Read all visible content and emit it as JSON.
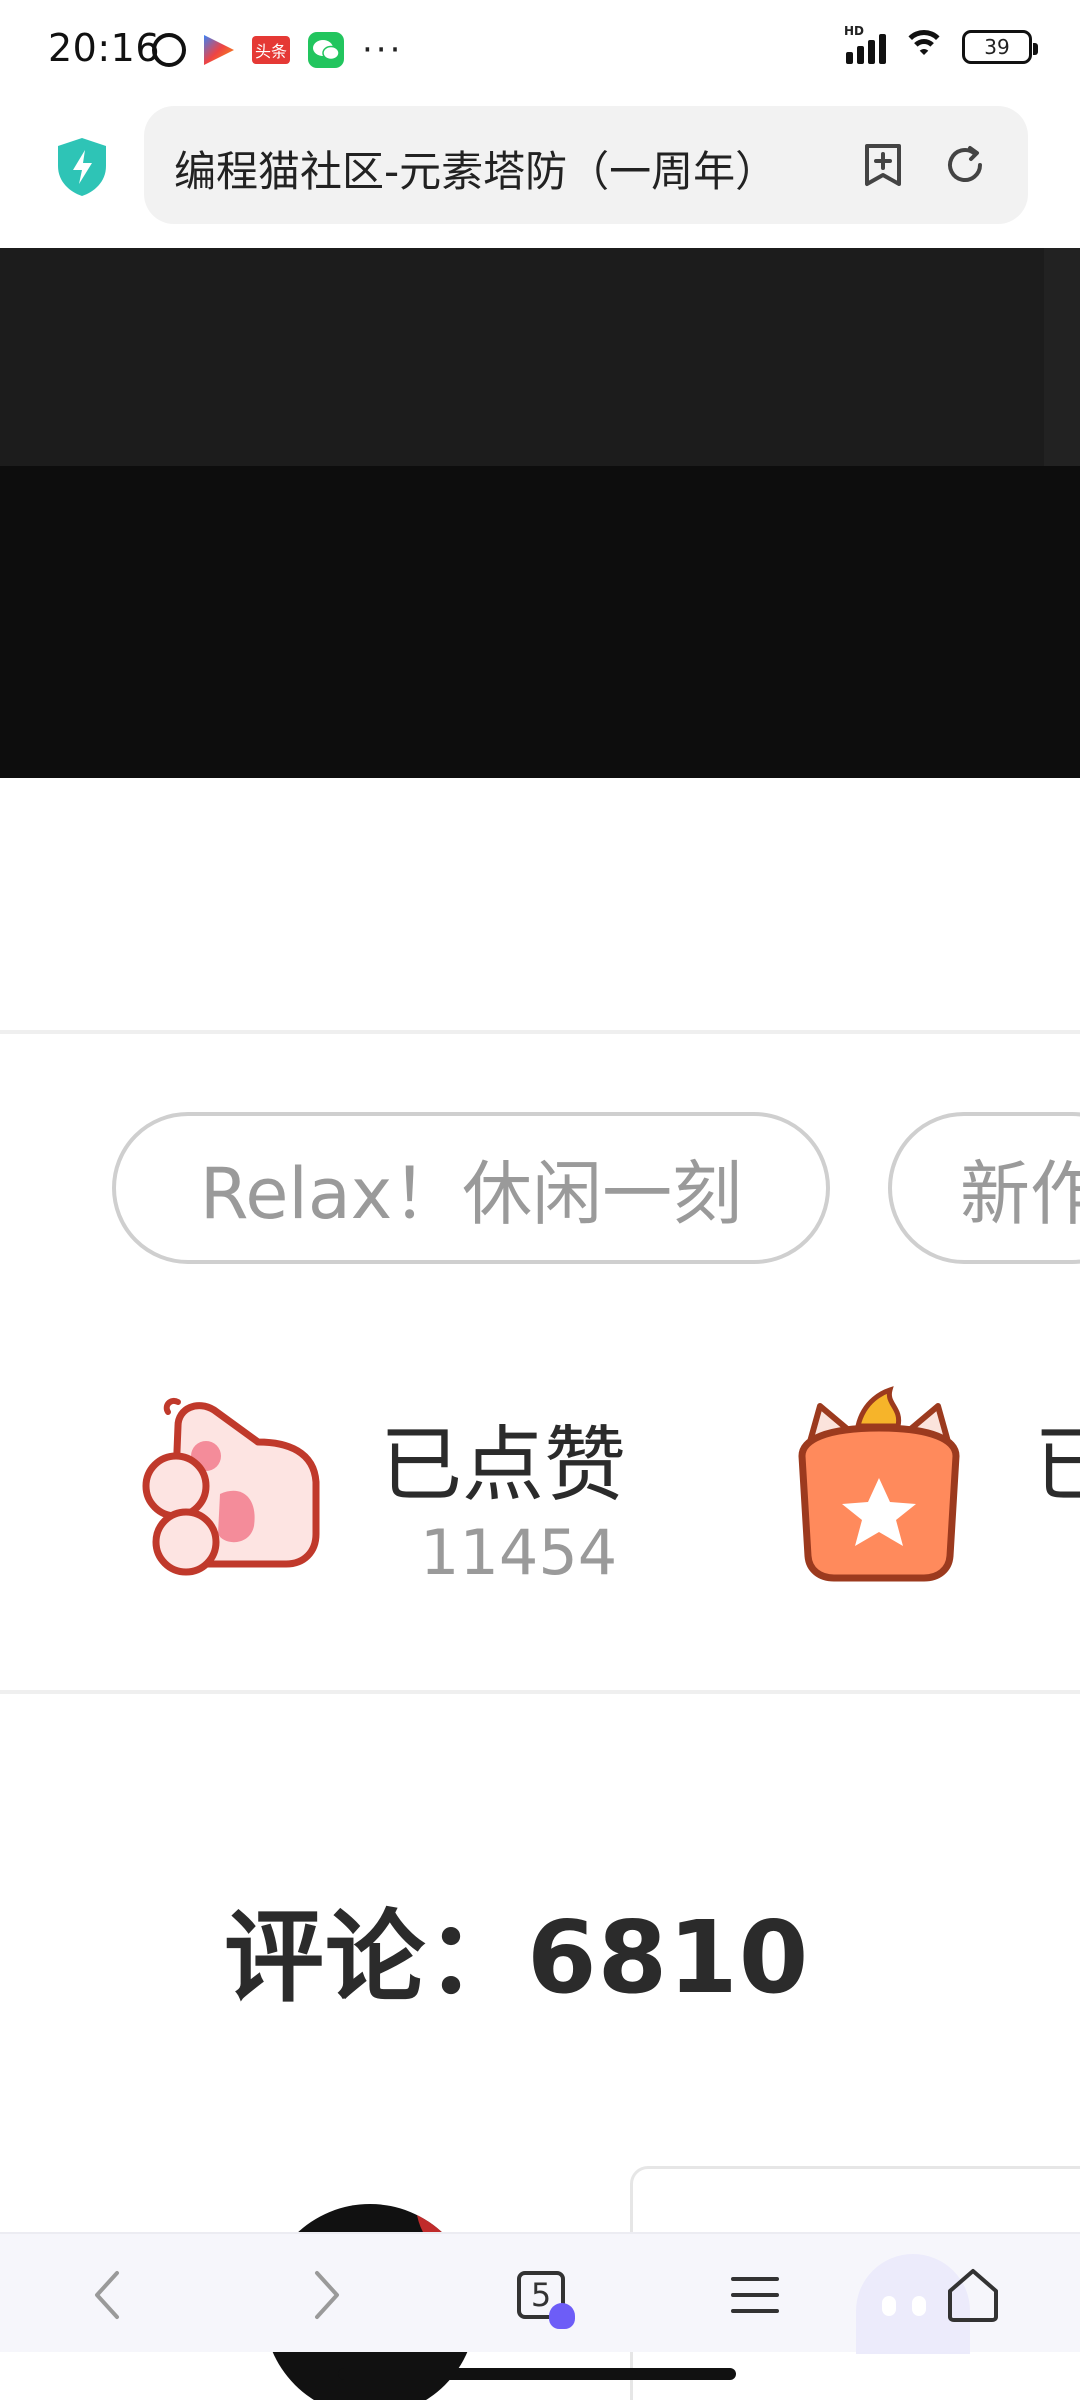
{
  "status_bar": {
    "time": "20:16",
    "notification_icons": [
      "alarm-icon",
      "play-store-icon",
      "toutiao-icon",
      "wechat-icon"
    ],
    "toutiao_label": "头条",
    "overflow": "···",
    "network_label": "HD",
    "battery_level": "39"
  },
  "browser": {
    "page_title": "编程猫社区-元素塔防（一周年）",
    "security_icon": "shield-bolt-icon",
    "bookmark_icon": "add-bookmark-icon",
    "reload_icon": "reload-icon"
  },
  "tags": [
    "Relax！休闲一刻",
    "新作"
  ],
  "stats": {
    "like": {
      "label": "已点赞",
      "count": "11454",
      "icon": "paw-thumb-icon"
    },
    "collect": {
      "label": "已",
      "icon": "cat-gift-star-icon"
    }
  },
  "comments": {
    "label": "评论：6810"
  },
  "bottom_nav": {
    "back_icon": "chevron-left-icon",
    "forward_icon": "chevron-right-icon",
    "tab_count": "5",
    "menu_icon": "hamburger-menu-icon",
    "home_icon": "home-icon"
  },
  "colors": {
    "banner_top": "#1c1c1c",
    "banner_bottom": "#0d0d0d",
    "tag_border": "#cfcfcf",
    "tag_text": "#9a9a9a",
    "accent_shield": "#2ec4b6",
    "paw_outline": "#c0392b",
    "gift_fill": "#ff8a5c"
  }
}
